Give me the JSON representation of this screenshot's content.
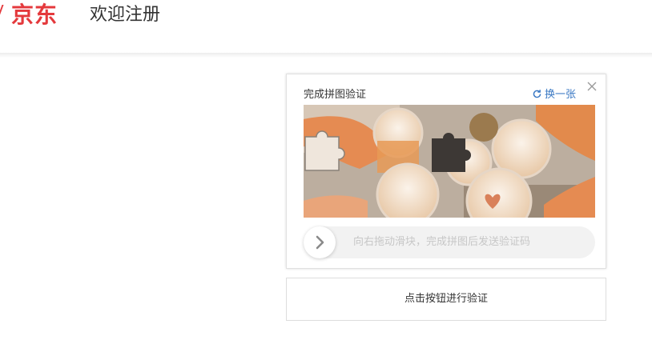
{
  "header": {
    "logo_text": "京东",
    "page_title": "欢迎注册",
    "brand_color": "#e4393c"
  },
  "captcha": {
    "title": "完成拼图验证",
    "refresh_label": "换一张",
    "refresh_icon": "refresh-icon",
    "close_icon": "close-icon",
    "image_desc_icon": "puzzle-piece-icon",
    "slider_hint": "向右拖动滑块，完成拼图后发送验证码",
    "slider_icon": "chevron-right-icon",
    "accent_color": "#3a78c3"
  },
  "verify_button": {
    "label": "点击按钮进行验证"
  }
}
